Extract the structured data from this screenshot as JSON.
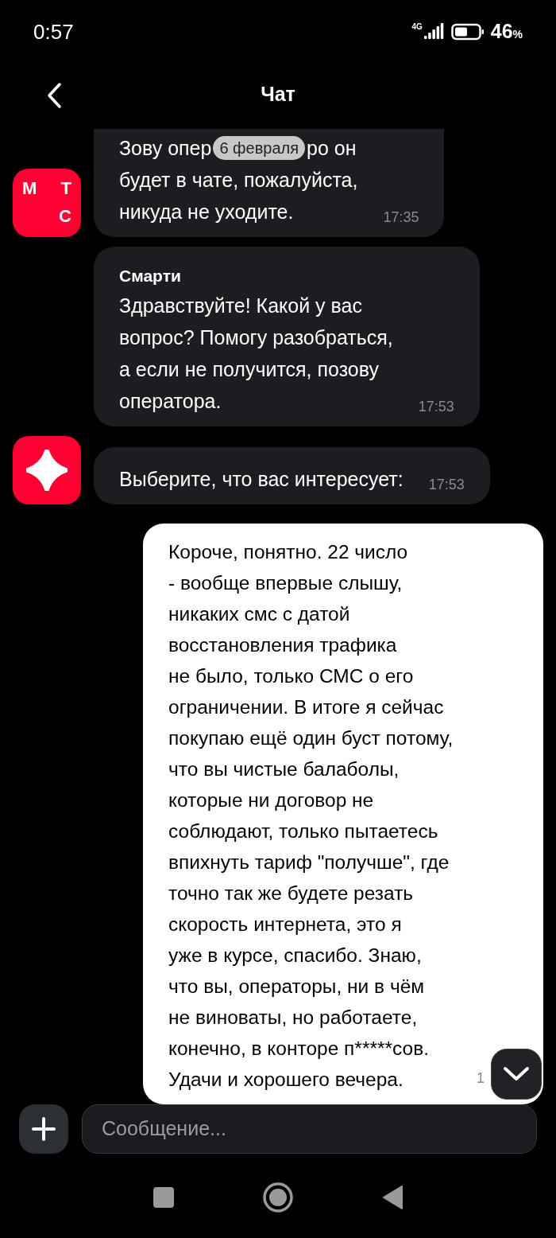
{
  "status_bar": {
    "time": "0:57",
    "network": "4G",
    "battery": "46",
    "battery_unit": "%"
  },
  "header": {
    "title": "Чат"
  },
  "date_pill": "6 февраля",
  "messages": [
    {
      "kind": "incoming",
      "avatar": {
        "kind": "logo",
        "letters": [
          "М",
          "Т",
          "С"
        ]
      },
      "clipped": true,
      "covered_line": [
        "Зову опер",
        "ро он"
      ],
      "lines": [
        "будет в чате, пожалуйста,",
        "никуда не уходите."
      ],
      "time": "17:35"
    },
    {
      "kind": "incoming",
      "sender": "Смарти",
      "lines": [
        "Здравствуйте! Какой у вас",
        "вопрос? Помогу разобраться,",
        "а если не получится, позову",
        "оператора."
      ],
      "time": "17:53"
    },
    {
      "kind": "incoming",
      "avatar": {
        "kind": "star"
      },
      "lines": [
        "Выберите, что вас интересует:"
      ],
      "time": "17:53"
    },
    {
      "kind": "outgoing",
      "lines": [
        "Короче, понятно. 22 число",
        "- вообще впервые слышу,",
        "никаких смс с датой",
        "восстановления трафика",
        "не было, только СМС о его",
        "ограничении. В итоге я сейчас",
        "покупаю ещё один буст потому,",
        "что вы чистые балаболы,",
        "которые ни договор не",
        "соблюдают, только пытаетесь",
        "впихнуть тариф \"получше\", где",
        "точно так же будете резать",
        "скорость интернета, это я",
        "уже в курсе, спасибо. Знаю,",
        "что вы, операторы, ни в чём",
        "не виноваты, но работаете,",
        "конечно, в конторе п*****сов.",
        "Удачи и хорошего вечера."
      ],
      "time": "1"
    }
  ],
  "composer": {
    "placeholder": "Сообщение..."
  }
}
